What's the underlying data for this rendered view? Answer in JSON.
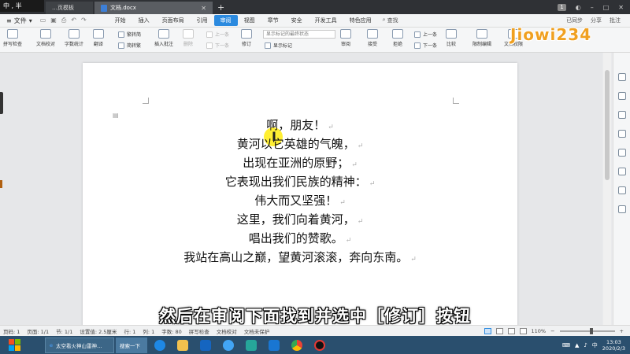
{
  "titlebar": {
    "ime_label": "中 , 半",
    "tab_inactive": "…页模板",
    "tab_active": "文档.docx",
    "new_tab": "+",
    "badge": "1"
  },
  "menubar": {
    "file": "文件",
    "tabs": [
      "开始",
      "插入",
      "页面布局",
      "引用",
      "审阅",
      "视图",
      "章节",
      "安全",
      "开发工具",
      "特色应用"
    ],
    "active_tab": "审阅",
    "search": "查找",
    "right_items": [
      "已同步",
      "分享",
      "批注"
    ]
  },
  "ribbon": {
    "spellcheck": "拼写检查",
    "doc_proof": "文档校对",
    "word_count": "字数统计",
    "translate": "翻译",
    "trad_to_simp": "繁转简",
    "simp_to_trad": "简转繁",
    "insert_comment": "插入批注",
    "delete": "删除",
    "prev_comment": "上一条",
    "next_comment": "下一条",
    "track_changes": "修订",
    "markup_select": "显示标记的最终状态",
    "show_markup": "显示标记",
    "review": "审阅",
    "accept": "接受",
    "reject": "拒绝",
    "prev": "上一条",
    "next": "下一条",
    "compare": "比较",
    "restrict_edit": "限制编辑",
    "doc_rights": "文档权限",
    "watermark_logo": "Jiowi234"
  },
  "document": {
    "lines": [
      "啊，朋友！",
      "黄河以它英雄的气魄，",
      "出现在亚洲的原野；",
      "它表现出我们民族的精神：",
      "伟大而又坚强！",
      "这里，我们向着黄河，",
      "唱出我们的赞歌。",
      "我站在高山之巅，望黄河滚滚，奔向东南。"
    ]
  },
  "subtitle": "然后在审阅下面找到并选中［修订］按钮",
  "statusbar": {
    "page_num": "页码: 1",
    "pages": "页面: 1/1",
    "section": "节: 1/1",
    "setting": "设置值: 2.5厘米",
    "row": "行: 1",
    "col": "列: 1",
    "word_count": "字数: 80",
    "spellcheck": "拼写检查",
    "proof": "文档校对",
    "protection": "文档未保护",
    "zoom": "110%"
  },
  "taskbar": {
    "browser_item": "太空看火神山雷神…",
    "search_item": "搜索一下",
    "tray_ime": "中",
    "time": "13:03",
    "date": "2020/2/3"
  },
  "colors": {
    "accent": "#2b8adf",
    "title_bg": "#2f3135",
    "taskbar_bg": "#2a4f6e",
    "highlight": "#ffeb00"
  }
}
